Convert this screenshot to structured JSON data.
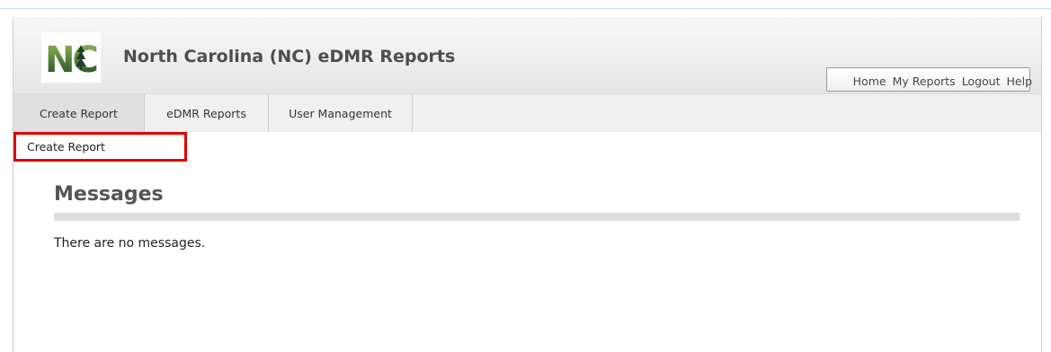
{
  "header": {
    "logo_text": "NC",
    "title": "North Carolina (NC) eDMR Reports",
    "links": [
      "Home",
      "My Reports",
      "Logout",
      "Help"
    ]
  },
  "nav": {
    "tabs": [
      {
        "label": "Create Report",
        "active": true
      },
      {
        "label": "eDMR Reports",
        "active": false
      },
      {
        "label": "User Management",
        "active": false
      }
    ]
  },
  "subnav": {
    "items": [
      {
        "label": "Create Report"
      }
    ]
  },
  "main": {
    "heading": "Messages",
    "message": "There are no messages."
  },
  "colors": {
    "highlight_border": "#e20000",
    "logo_dark": "#1b3f2c",
    "logo_light": "#8fb04a"
  }
}
